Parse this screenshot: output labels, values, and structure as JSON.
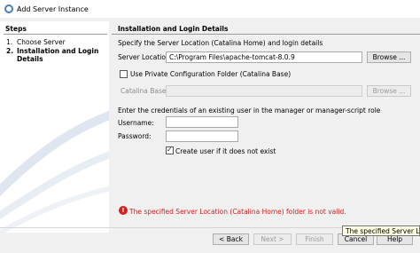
{
  "window": {
    "title": "Add Server Instance",
    "icon": "netbeans-icon"
  },
  "steps": {
    "heading": "Steps",
    "items": [
      {
        "num": "1.",
        "label": "Choose Server",
        "active": false
      },
      {
        "num": "2.",
        "label": "Installation and Login",
        "label2": "Details",
        "active": true
      }
    ]
  },
  "content": {
    "heading": "Installation and Login Details",
    "intro": "Specify the Server Location (Catalina Home) and login details",
    "server_location_label": "Server Location:",
    "server_location_value": "C:\\Program Files\\apache-tomcat-8.0.9",
    "browse_label": "Browse ...",
    "private_config_label": "Use Private Configuration Folder (Catalina Base)",
    "private_config_checked": false,
    "catalina_base_label": "Catalina Base:",
    "catalina_base_value": "",
    "browse2_label": "Browse ...",
    "credentials_text": "Enter the credentials of an existing user in the manager or manager-script role",
    "username_label": "Username:",
    "username_value": "",
    "password_label": "Password:",
    "password_value": "",
    "create_user_label": "Create user if it does not exist",
    "create_user_checked": true,
    "error_icon": "error-icon",
    "error_message": "The specified Server Location (Catalina Home) folder is not valid."
  },
  "footer": {
    "back_label": "< Back",
    "next_label": "Next >",
    "finish_label": "Finish",
    "cancel_label": "Cancel",
    "help_label": "Help"
  },
  "tooltip": {
    "text": "The specified Server Locatio"
  },
  "colors": {
    "error": "#d42020",
    "accent": "#4a7cc4"
  }
}
